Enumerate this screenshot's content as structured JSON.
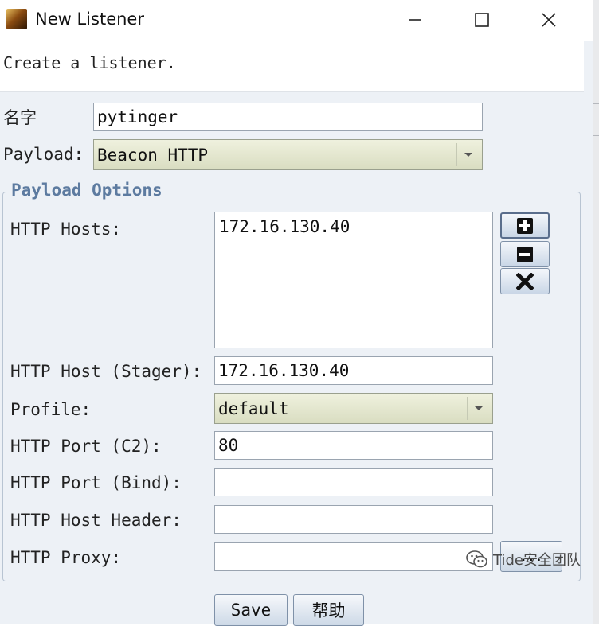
{
  "window": {
    "title": "New Listener",
    "app_icon": "cobalt-strike-icon",
    "controls": [
      "minimize-icon",
      "maximize-icon",
      "close-icon"
    ]
  },
  "dialog": {
    "description": "Create a listener."
  },
  "form": {
    "name_label": "名字",
    "name_value": "pytinger",
    "payload_label": "Payload:",
    "payload_value": "Beacon HTTP"
  },
  "payload_options": {
    "title": "Payload Options",
    "http_hosts_label": "HTTP Hosts:",
    "http_hosts": [
      "172.16.130.40"
    ],
    "host_buttons": [
      "add-icon",
      "remove-icon",
      "clear-icon"
    ],
    "stager_host_label": "HTTP Host (Stager):",
    "stager_host_value": "172.16.130.40",
    "profile_label": "Profile:",
    "profile_value": "default",
    "port_c2_label": "HTTP Port (C2):",
    "port_c2_value": "80",
    "port_bind_label": "HTTP Port (Bind):",
    "port_bind_value": "",
    "host_header_label": "HTTP Host Header:",
    "host_header_value": "",
    "proxy_label": "HTTP Proxy:",
    "proxy_value": "",
    "proxy_button_label": "..."
  },
  "buttons": {
    "save_label": "Save",
    "help_label": "帮助"
  },
  "watermark": {
    "text": "Tide安全团队"
  },
  "colors": {
    "dialog_bg": "#edf1f6",
    "combo_bg": "#e3e7cf",
    "group_title": "#5d7ba0"
  }
}
